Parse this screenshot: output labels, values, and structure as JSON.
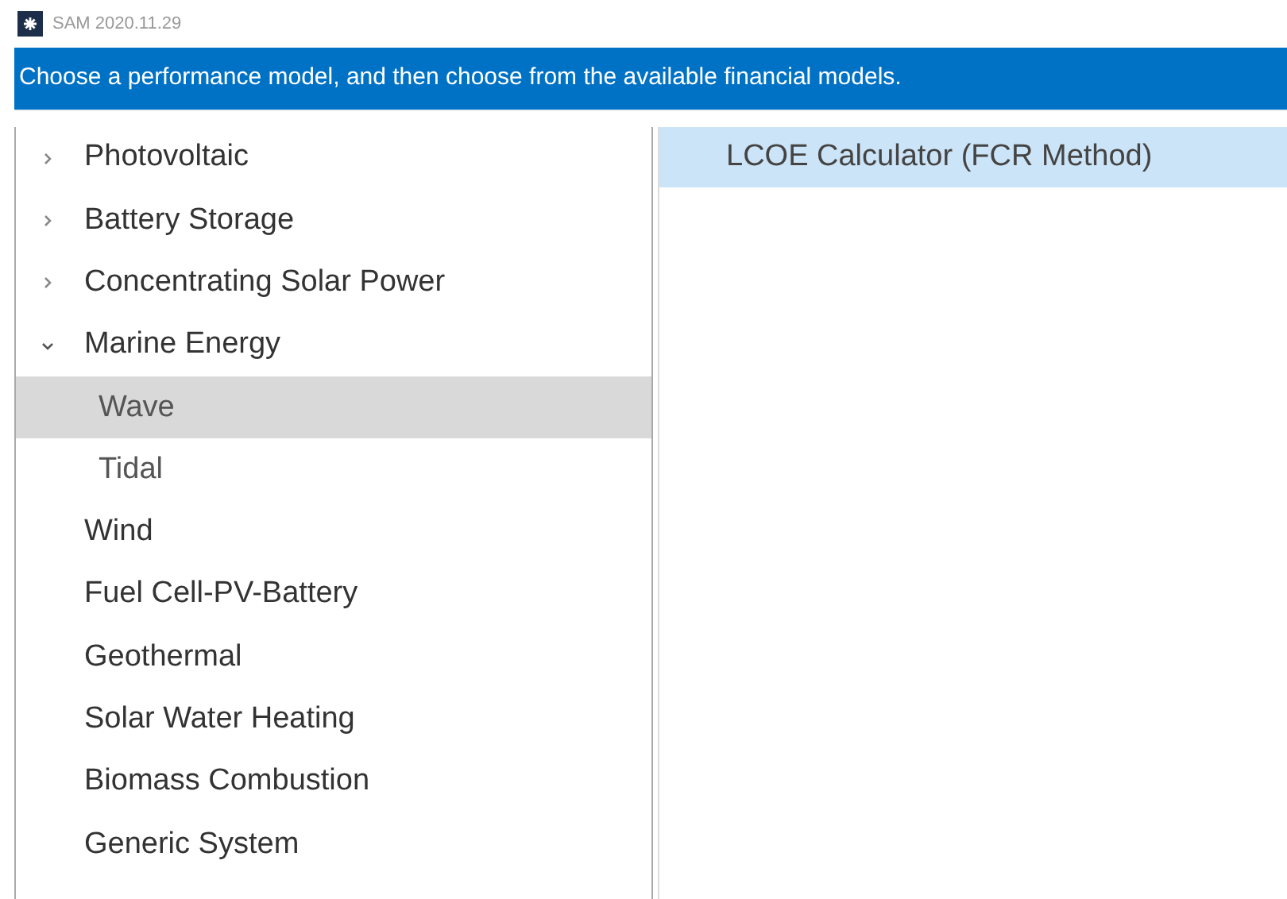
{
  "window": {
    "title": "SAM 2020.11.29"
  },
  "banner": "Choose a performance model, and then choose from the available financial models.",
  "performance_models": [
    {
      "label": "Photovoltaic",
      "kind": "group",
      "expanded": false,
      "selected": false
    },
    {
      "label": "Battery Storage",
      "kind": "group",
      "expanded": false,
      "selected": false
    },
    {
      "label": "Concentrating Solar Power",
      "kind": "group",
      "expanded": false,
      "selected": false
    },
    {
      "label": "Marine Energy",
      "kind": "group",
      "expanded": true,
      "selected": false,
      "children": [
        {
          "label": "Wave",
          "selected": true
        },
        {
          "label": "Tidal",
          "selected": false
        }
      ]
    },
    {
      "label": "Wind",
      "kind": "leaf",
      "selected": false
    },
    {
      "label": "Fuel Cell-PV-Battery",
      "kind": "leaf",
      "selected": false
    },
    {
      "label": "Geothermal",
      "kind": "leaf",
      "selected": false
    },
    {
      "label": "Solar Water Heating",
      "kind": "leaf",
      "selected": false
    },
    {
      "label": "Biomass Combustion",
      "kind": "leaf",
      "selected": false
    },
    {
      "label": "Generic System",
      "kind": "leaf",
      "selected": false
    }
  ],
  "financial_models": [
    {
      "label": "LCOE Calculator (FCR Method)",
      "selected": true
    }
  ]
}
